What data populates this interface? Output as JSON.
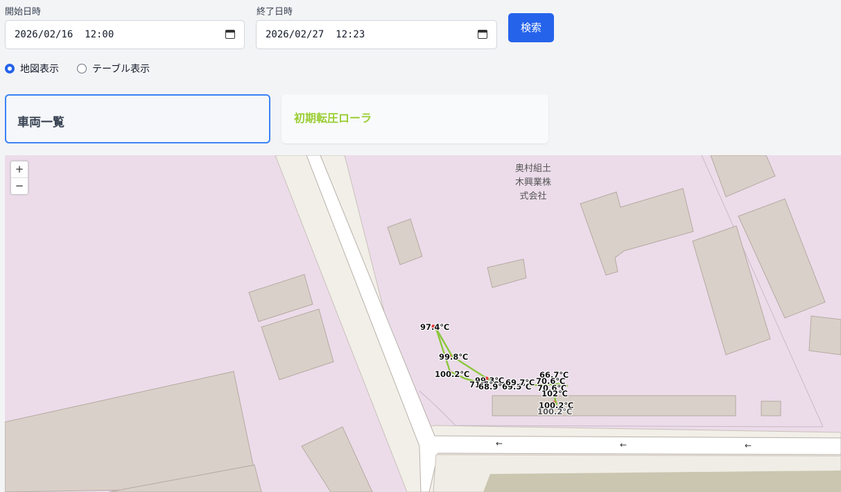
{
  "filters": {
    "start_label": "開始日時",
    "start_value": "2026/02/16  12:00",
    "end_label": "終了日時",
    "end_value": "2026/02/27  12:23",
    "search_label": "検索"
  },
  "view_mode": {
    "options": [
      "地図表示",
      "テーブル表示"
    ],
    "selected": "地図表示"
  },
  "cards": {
    "vehicle_list": "車両一覧",
    "vehicle_name": "初期転圧ローラ",
    "vehicle_name_color": "#9acd32"
  },
  "map": {
    "zoom_in": "+",
    "zoom_out": "−",
    "poi_name": "奥村組土\n木興業株\n式会社",
    "one_way_arrow": "←",
    "track_color": "#8cc63f",
    "temperature_labels": [
      "97.4℃",
      "99.8℃",
      "100.2℃",
      "99.3℃",
      "71.5℃",
      "68.9℃",
      "69.5℃",
      "69.7℃",
      "66.7℃",
      "70.6℃",
      "70.6℃",
      "102℃",
      "100.2℃",
      "100.2℃"
    ]
  }
}
